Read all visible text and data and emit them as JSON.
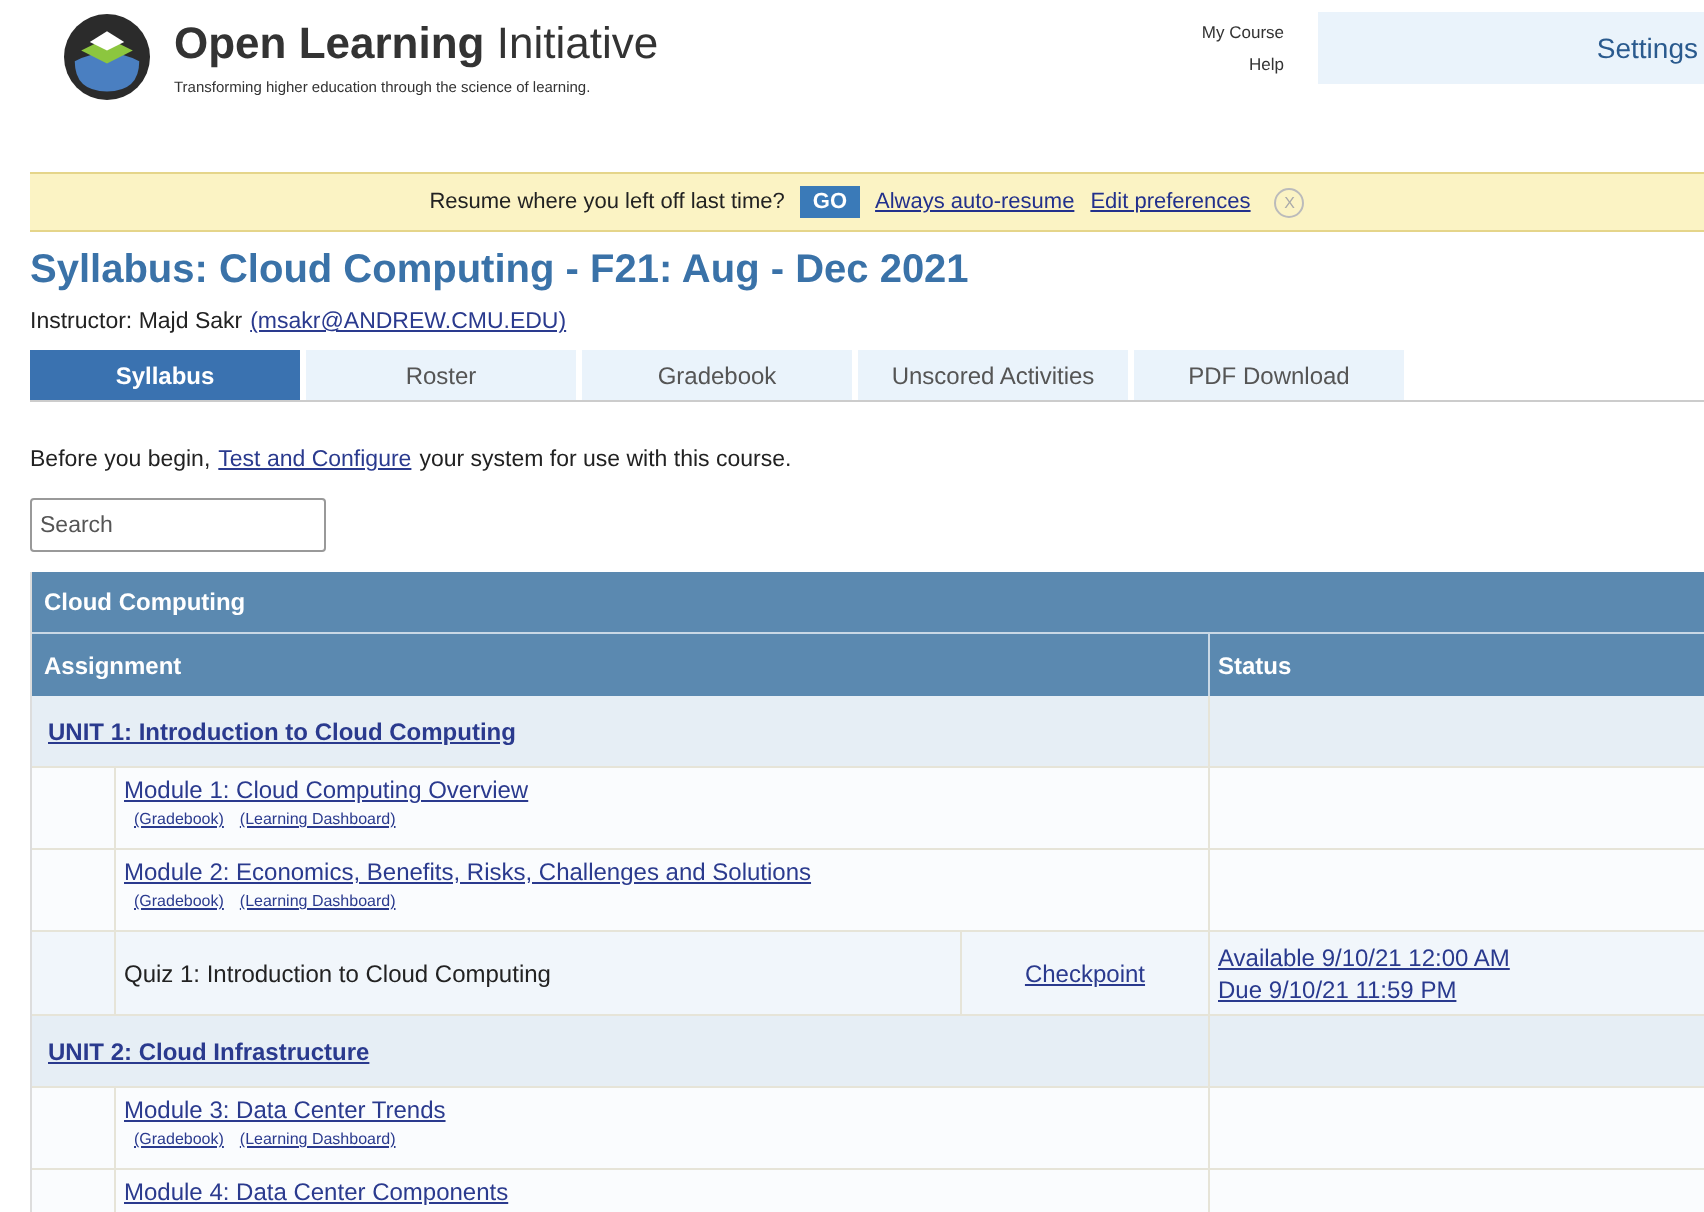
{
  "header": {
    "logo_title_bold": "Open Learning",
    "logo_title_light": "Initiative",
    "tagline": "Transforming higher education through the science of learning.",
    "nav": [
      "My Course",
      "Help"
    ],
    "settings": "Settings"
  },
  "resume_banner": {
    "prompt": "Resume where you left off last time?",
    "go": "GO",
    "links": [
      "Always auto-resume",
      "Edit preferences"
    ],
    "close": "X"
  },
  "title": "Syllabus: Cloud Computing - F21: Aug - Dec 2021",
  "instructor": {
    "label": "Instructor: Majd Sakr",
    "email": "(msakr@ANDREW.CMU.EDU)"
  },
  "tabs": [
    {
      "label": "Syllabus",
      "selected": true
    },
    {
      "label": "Roster",
      "selected": false
    },
    {
      "label": "Gradebook",
      "selected": false
    },
    {
      "label": "Unscored Activities",
      "selected": false
    },
    {
      "label": "PDF Download",
      "selected": false
    }
  ],
  "intro": {
    "before": "Before you begin,",
    "link": "Test and Configure",
    "after": "your system for use with this course."
  },
  "search": {
    "placeholder": "Search"
  },
  "table": {
    "caption": "Cloud Computing",
    "columns": [
      "Assignment",
      "Status"
    ],
    "rows": [
      {
        "kind": "unit",
        "title": "UNIT 1: Introduction to Cloud Computing"
      },
      {
        "kind": "module",
        "title": "Module 1: Cloud Computing Overview",
        "links": [
          "(Gradebook)",
          "(Learning Dashboard)"
        ]
      },
      {
        "kind": "module",
        "title": "Module 2: Economics, Benefits, Risks, Challenges and Solutions",
        "links": [
          "(Gradebook)",
          "(Learning Dashboard)"
        ]
      },
      {
        "kind": "activity",
        "title": "Quiz 1: Introduction to Cloud Computing",
        "type": "Checkpoint",
        "status": [
          "Available 9/10/21 12:00 AM",
          "Due 9/10/21 11:59 PM"
        ]
      },
      {
        "kind": "unit",
        "title": "UNIT 2: Cloud Infrastructure"
      },
      {
        "kind": "module",
        "title": "Module 3: Data Center Trends",
        "links": [
          "(Gradebook)",
          "(Learning Dashboard)"
        ]
      },
      {
        "kind": "module",
        "title": "Module 4: Data Center Components"
      }
    ]
  }
}
